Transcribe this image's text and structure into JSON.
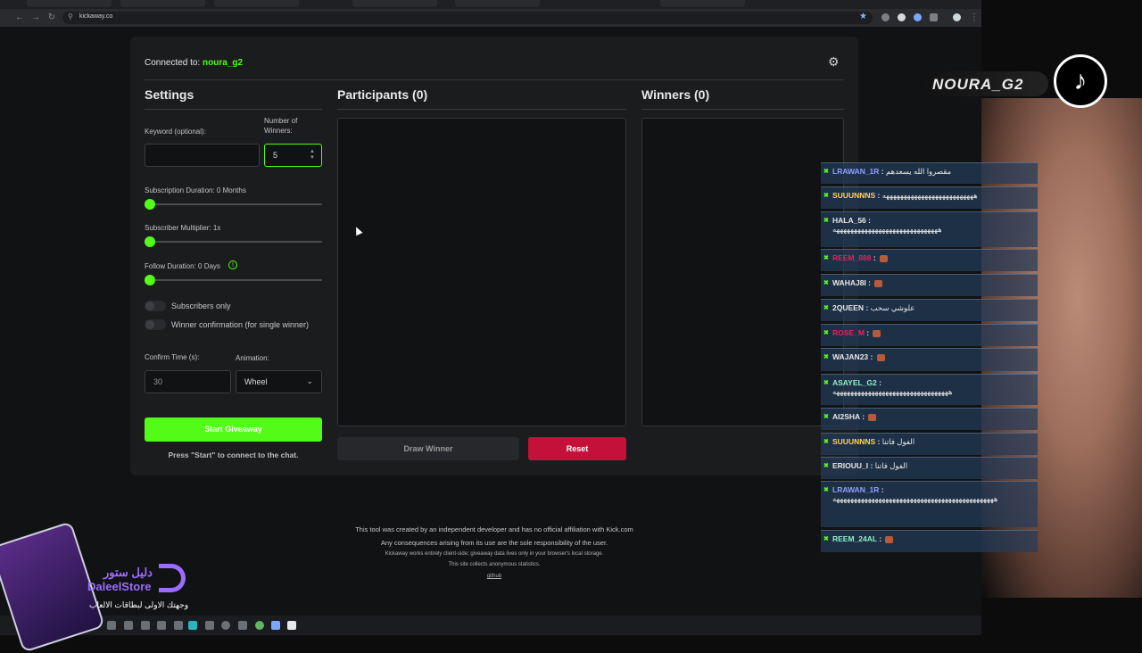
{
  "browser": {
    "url": "kickaway.co"
  },
  "header": {
    "connected_label": "Connected to:",
    "channel": "noura_g2"
  },
  "settings": {
    "title": "Settings",
    "keyword_label": "Keyword (optional):",
    "keyword_value": "",
    "winners_label_1": "Number of",
    "winners_label_2": "Winners:",
    "winners_value": "5",
    "sub_duration_label": "Subscription Duration: 0 Months",
    "sub_multiplier_label": "Subscriber Multiplier: 1x",
    "follow_duration_label": "Follow Duration: 0 Days",
    "subscribers_only_label": "Subscribers only",
    "winner_confirm_label": "Winner confirmation (for single winner)",
    "confirm_time_label": "Confirm Time (s):",
    "confirm_time_value": "30",
    "animation_label": "Animation:",
    "animation_value": "Wheel",
    "start_button": "Start Giveaway",
    "hint": "Press \"Start\" to connect to the chat."
  },
  "participants": {
    "title": "Participants (0)",
    "draw_button": "Draw Winner",
    "reset_button": "Reset"
  },
  "winners": {
    "title": "Winners (0)"
  },
  "footer": {
    "line1": "This tool was created by an independent developer and has no official affiliation with Kick.com",
    "line2": "Any consequences arising from its use are the sole responsibility of the user.",
    "line3": "Kickaway works entirely client-side; giveaway data lives only in your browser's local storage.",
    "line4": "This site collects anonymous statistics.",
    "link": "github"
  },
  "overlay": {
    "streamer": "NOURA_G2",
    "chat": [
      {
        "user": "LRAWAN_1R",
        "text": "مقصروا الله يسعدهم",
        "color": "#8ea0ff"
      },
      {
        "user": "SUUUNNNS",
        "text": "ههههههههههههههههههههههههههه",
        "color": "#ffd54a"
      },
      {
        "user": "HALA_56",
        "text": "ههههههههههههههههههههههههههههههه",
        "color": "#e8e8e8"
      },
      {
        "user": "REEM_888",
        "text": "",
        "color": "#e0245e"
      },
      {
        "user": "WAHAJ8I",
        "text": "",
        "color": "#e8e8e8"
      },
      {
        "user": "2QUEEN",
        "text": "علوشي سحب",
        "color": "#e8e8e8"
      },
      {
        "user": "ROSE_M",
        "text": "",
        "color": "#e0245e"
      },
      {
        "user": "WAJAN23",
        "text": "",
        "color": "#e8e8e8"
      },
      {
        "user": "ASAYEL_G2",
        "text": "هههههههههههههههههههههههههههههههههه",
        "color": "#8ff0c8"
      },
      {
        "user": "AI2SHA",
        "text": "",
        "color": "#e8e8e8"
      },
      {
        "user": "SUUUNNNS",
        "text": "الفول فاتنا",
        "color": "#ffd54a"
      },
      {
        "user": "ERIOUU_I",
        "text": "الفول فاتنا",
        "color": "#e8e8e8"
      },
      {
        "user": "LRAWAN_1R",
        "text": "ههههههههههههههههههههههههههههههههههههههههههههههه",
        "color": "#8ea0ff"
      },
      {
        "user": "REEM_24AL",
        "text": "",
        "color": "#8ff0c8"
      }
    ]
  },
  "store": {
    "name_ar": "دليل ستور",
    "name_en": "DaleelStore",
    "tagline": "وجهتك الاولى لبطاقات الالعاب"
  }
}
